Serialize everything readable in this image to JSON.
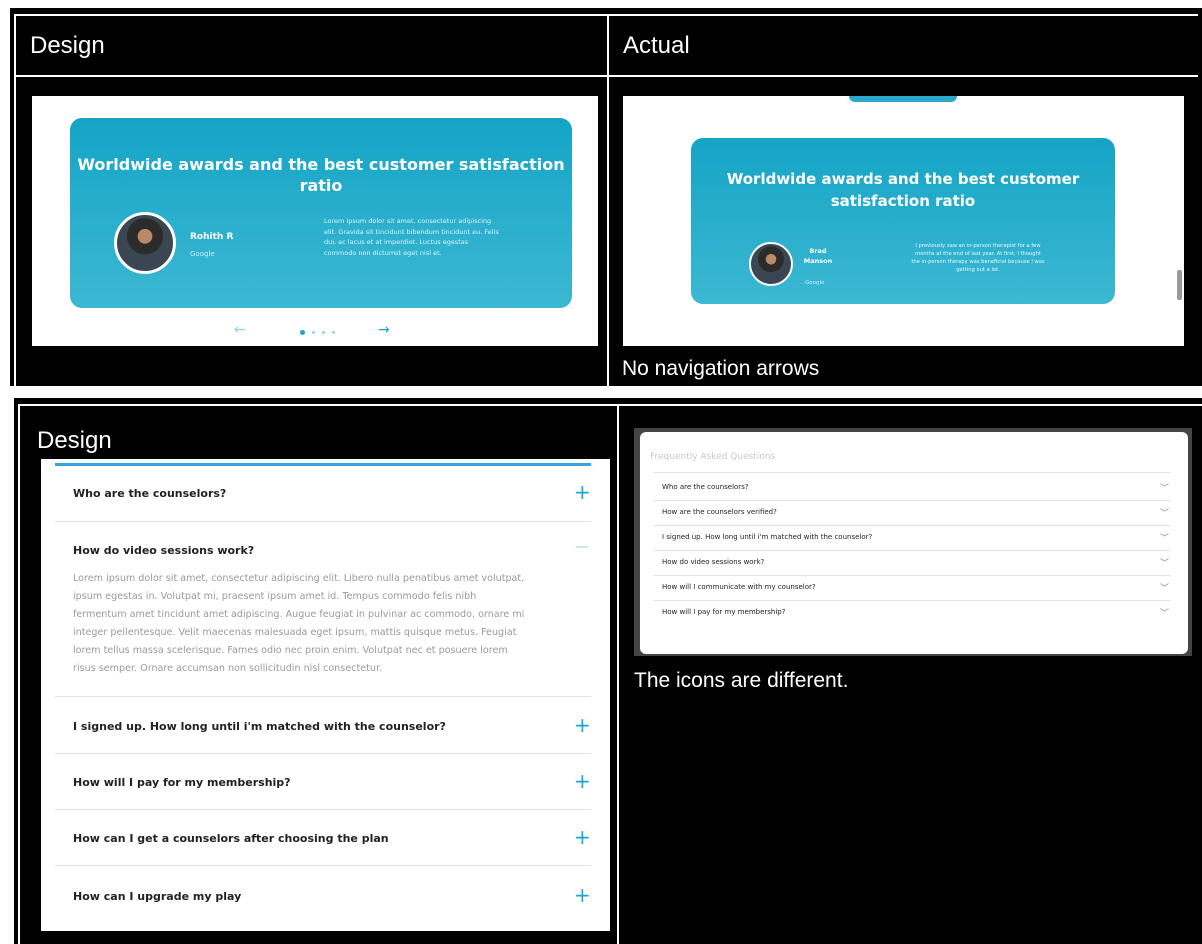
{
  "top": {
    "design_label": "Design",
    "actual_label": "Actual",
    "caption": "No navigation arrows",
    "design_card": {
      "title_line1": "Worldwide awards and the best customer satisfaction",
      "title_line2": "ratio",
      "name": "Rohith R",
      "company": "Google",
      "quote_lines": [
        "Lorem ipsum dolor sit amet, consectetur adipiscing",
        "elit. Gravida sit tincidunt bibendum tincidunt eu. Felis",
        "dui, ac lacus et at imperdiet. Luctus egestas",
        "commodo non dictumst eget nisl et."
      ],
      "nav_prev": "←",
      "nav_next": "→"
    },
    "actual_card": {
      "title_line1": "Worldwide awards and the best customer",
      "title_line2": "satisfaction ratio",
      "name_line1": "Brad",
      "name_line2": "Manson",
      "company": "Google",
      "quote_lines": [
        "I previously saw an in-person therapist for a few",
        "months at the end of last year. At first, I thought",
        "the in-person therapy was beneficial because I was",
        "getting out a lot."
      ]
    }
  },
  "bottom": {
    "design_label": "Design",
    "caption": "The icons are different.",
    "design_faq": [
      {
        "q": "Who are the counselors?",
        "icon": "+"
      },
      {
        "q": "How do video sessions work?",
        "icon": "—"
      },
      {
        "q": "I signed up. How long until i'm matched with the counselor?",
        "icon": "+"
      },
      {
        "q": "How will I pay for my membership?",
        "icon": "+"
      },
      {
        "q": "How can I get a counselors after choosing the plan",
        "icon": "+"
      },
      {
        "q": "How can I upgrade my play",
        "icon": "+"
      }
    ],
    "answer_lines": [
      "Lorem ipsum dolor sit amet, consectetur adipiscing elit. Libero nulla penatibus amet volutpat,",
      "ipsum egestas in. Volutpat mi, praesent ipsum amet id. Tempus commodo felis nibh",
      "fermentum amet tincidunt amet adipiscing. Augue feugiat in pulvinar ac commodo, ornare mi",
      "integer pellentesque. Velit maecenas malesuada eget ipsum, mattis quisque metus. Feugiat",
      "lorem tellus massa scelerisque. Fames odio nec proin enim. Volutpat nec et posuere lorem",
      "risus semper. Ornare accumsan non sollicitudin nisl consectetur."
    ],
    "actual_faq_title": "Frequently Asked Questions",
    "actual_faq": [
      "Who are the counselors?",
      "How are the counselors verified?",
      "I signed up. How long until i'm matched with the counselor?",
      "How do video sessions work?",
      "How will I communicate with my counselor?",
      "How will I pay for my membership?"
    ],
    "chevron": "﹀"
  },
  "colors": {
    "accent": "#1aa6cf",
    "card_gradient_top": "#15a4c6",
    "card_gradient_bottom": "#3cb8d2"
  }
}
